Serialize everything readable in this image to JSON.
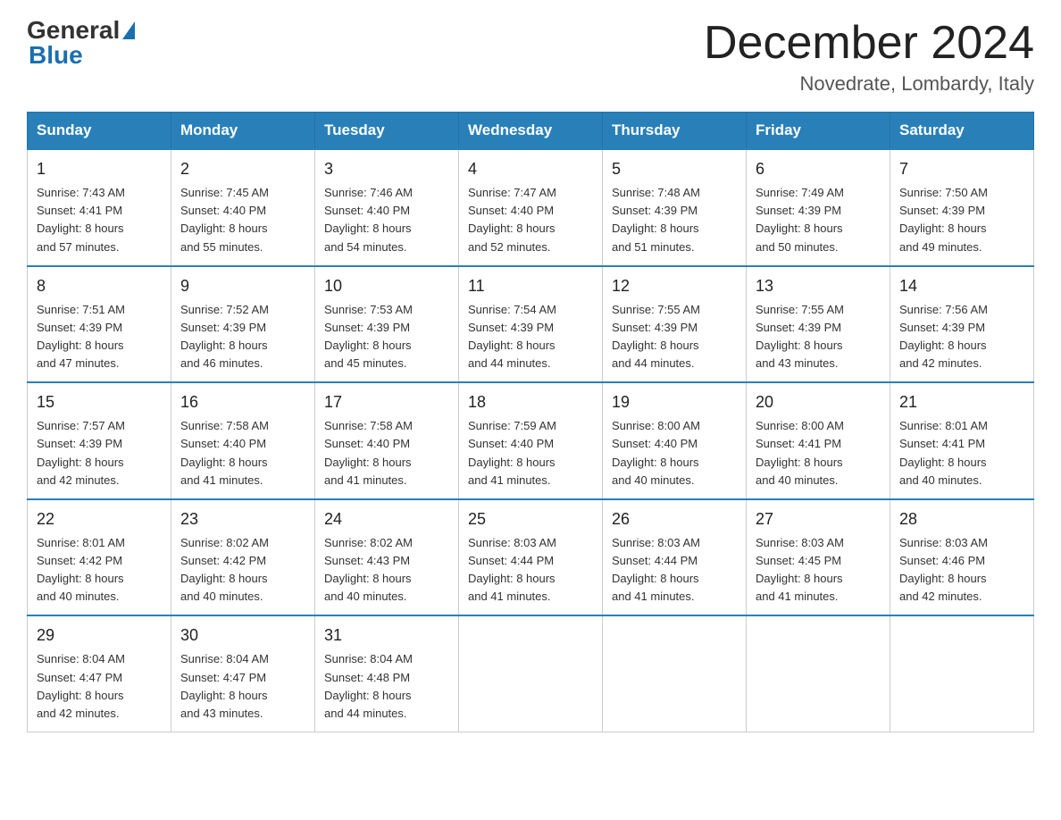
{
  "header": {
    "logo_text_general": "General",
    "logo_text_blue": "Blue",
    "month_title": "December 2024",
    "location": "Novedrate, Lombardy, Italy"
  },
  "days_of_week": [
    "Sunday",
    "Monday",
    "Tuesday",
    "Wednesday",
    "Thursday",
    "Friday",
    "Saturday"
  ],
  "weeks": [
    [
      {
        "day": "1",
        "sunrise": "7:43 AM",
        "sunset": "4:41 PM",
        "daylight": "8 hours and 57 minutes."
      },
      {
        "day": "2",
        "sunrise": "7:45 AM",
        "sunset": "4:40 PM",
        "daylight": "8 hours and 55 minutes."
      },
      {
        "day": "3",
        "sunrise": "7:46 AM",
        "sunset": "4:40 PM",
        "daylight": "8 hours and 54 minutes."
      },
      {
        "day": "4",
        "sunrise": "7:47 AM",
        "sunset": "4:40 PM",
        "daylight": "8 hours and 52 minutes."
      },
      {
        "day": "5",
        "sunrise": "7:48 AM",
        "sunset": "4:39 PM",
        "daylight": "8 hours and 51 minutes."
      },
      {
        "day": "6",
        "sunrise": "7:49 AM",
        "sunset": "4:39 PM",
        "daylight": "8 hours and 50 minutes."
      },
      {
        "day": "7",
        "sunrise": "7:50 AM",
        "sunset": "4:39 PM",
        "daylight": "8 hours and 49 minutes."
      }
    ],
    [
      {
        "day": "8",
        "sunrise": "7:51 AM",
        "sunset": "4:39 PM",
        "daylight": "8 hours and 47 minutes."
      },
      {
        "day": "9",
        "sunrise": "7:52 AM",
        "sunset": "4:39 PM",
        "daylight": "8 hours and 46 minutes."
      },
      {
        "day": "10",
        "sunrise": "7:53 AM",
        "sunset": "4:39 PM",
        "daylight": "8 hours and 45 minutes."
      },
      {
        "day": "11",
        "sunrise": "7:54 AM",
        "sunset": "4:39 PM",
        "daylight": "8 hours and 44 minutes."
      },
      {
        "day": "12",
        "sunrise": "7:55 AM",
        "sunset": "4:39 PM",
        "daylight": "8 hours and 44 minutes."
      },
      {
        "day": "13",
        "sunrise": "7:55 AM",
        "sunset": "4:39 PM",
        "daylight": "8 hours and 43 minutes."
      },
      {
        "day": "14",
        "sunrise": "7:56 AM",
        "sunset": "4:39 PM",
        "daylight": "8 hours and 42 minutes."
      }
    ],
    [
      {
        "day": "15",
        "sunrise": "7:57 AM",
        "sunset": "4:39 PM",
        "daylight": "8 hours and 42 minutes."
      },
      {
        "day": "16",
        "sunrise": "7:58 AM",
        "sunset": "4:40 PM",
        "daylight": "8 hours and 41 minutes."
      },
      {
        "day": "17",
        "sunrise": "7:58 AM",
        "sunset": "4:40 PM",
        "daylight": "8 hours and 41 minutes."
      },
      {
        "day": "18",
        "sunrise": "7:59 AM",
        "sunset": "4:40 PM",
        "daylight": "8 hours and 41 minutes."
      },
      {
        "day": "19",
        "sunrise": "8:00 AM",
        "sunset": "4:40 PM",
        "daylight": "8 hours and 40 minutes."
      },
      {
        "day": "20",
        "sunrise": "8:00 AM",
        "sunset": "4:41 PM",
        "daylight": "8 hours and 40 minutes."
      },
      {
        "day": "21",
        "sunrise": "8:01 AM",
        "sunset": "4:41 PM",
        "daylight": "8 hours and 40 minutes."
      }
    ],
    [
      {
        "day": "22",
        "sunrise": "8:01 AM",
        "sunset": "4:42 PM",
        "daylight": "8 hours and 40 minutes."
      },
      {
        "day": "23",
        "sunrise": "8:02 AM",
        "sunset": "4:42 PM",
        "daylight": "8 hours and 40 minutes."
      },
      {
        "day": "24",
        "sunrise": "8:02 AM",
        "sunset": "4:43 PM",
        "daylight": "8 hours and 40 minutes."
      },
      {
        "day": "25",
        "sunrise": "8:03 AM",
        "sunset": "4:44 PM",
        "daylight": "8 hours and 41 minutes."
      },
      {
        "day": "26",
        "sunrise": "8:03 AM",
        "sunset": "4:44 PM",
        "daylight": "8 hours and 41 minutes."
      },
      {
        "day": "27",
        "sunrise": "8:03 AM",
        "sunset": "4:45 PM",
        "daylight": "8 hours and 41 minutes."
      },
      {
        "day": "28",
        "sunrise": "8:03 AM",
        "sunset": "4:46 PM",
        "daylight": "8 hours and 42 minutes."
      }
    ],
    [
      {
        "day": "29",
        "sunrise": "8:04 AM",
        "sunset": "4:47 PM",
        "daylight": "8 hours and 42 minutes."
      },
      {
        "day": "30",
        "sunrise": "8:04 AM",
        "sunset": "4:47 PM",
        "daylight": "8 hours and 43 minutes."
      },
      {
        "day": "31",
        "sunrise": "8:04 AM",
        "sunset": "4:48 PM",
        "daylight": "8 hours and 44 minutes."
      },
      null,
      null,
      null,
      null
    ]
  ],
  "labels": {
    "sunrise": "Sunrise:",
    "sunset": "Sunset:",
    "daylight": "Daylight:"
  }
}
